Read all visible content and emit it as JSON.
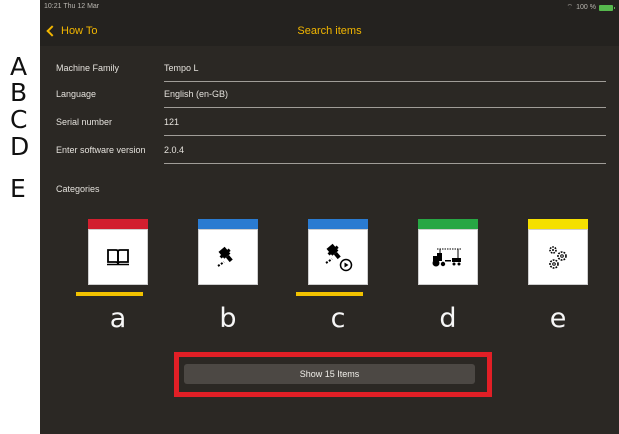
{
  "status_bar": {
    "time": "10:21  Thu 12 Mar",
    "battery": "100 %"
  },
  "nav": {
    "back_label": "How To",
    "title": "Search items"
  },
  "side_letters": [
    "A",
    "B",
    "C",
    "D",
    "E"
  ],
  "form": {
    "rows": [
      {
        "label": "Machine Family",
        "value": "Tempo L"
      },
      {
        "label": "Language",
        "value": "English (en-GB)"
      },
      {
        "label": "Serial number",
        "value": "121"
      },
      {
        "label": "Enter software version",
        "value": "2.0.4"
      }
    ]
  },
  "categories": {
    "title": "Categories",
    "items": [
      {
        "letter": "a",
        "color": "#d21f2f",
        "icon": "book-icon",
        "selected": true
      },
      {
        "letter": "b",
        "color": "#2a7bd1",
        "icon": "planter-icon",
        "selected": false
      },
      {
        "letter": "c",
        "color": "#2a7bd1",
        "icon": "planter-play-icon",
        "selected": true
      },
      {
        "letter": "d",
        "color": "#27a744",
        "icon": "tractor-icon",
        "selected": false
      },
      {
        "letter": "e",
        "color": "#f5e000",
        "icon": "gears-icon",
        "selected": false
      }
    ]
  },
  "action": {
    "show_label": "Show 15 Items",
    "highlight_color": "#e11f26"
  }
}
